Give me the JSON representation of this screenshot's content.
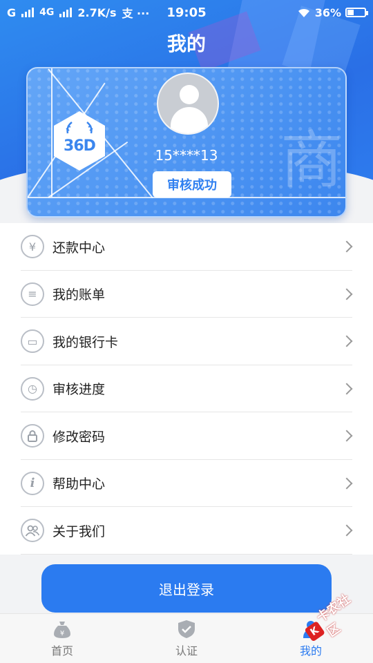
{
  "statusbar": {
    "left_carriers": "G",
    "left_4g": "4G",
    "speed": "2.7K/s",
    "extra": "支 ···",
    "time": "19:05",
    "battery": "36%"
  },
  "header": {
    "title": "我的"
  },
  "profile": {
    "badge_text": "36D",
    "watermark": "商",
    "phone": "15****13",
    "status": "审核成功"
  },
  "menu": {
    "items": [
      {
        "label": "还款中心",
        "icon": "repay-icon",
        "glyph": "¥"
      },
      {
        "label": "我的账单",
        "icon": "bill-icon",
        "glyph": "≡"
      },
      {
        "label": "我的银行卡",
        "icon": "bank-card-icon",
        "glyph": "▭"
      },
      {
        "label": "审核进度",
        "icon": "progress-icon",
        "glyph": "◷"
      },
      {
        "label": "修改密码",
        "icon": "lock-icon",
        "glyph": "🔒"
      },
      {
        "label": "帮助中心",
        "icon": "info-icon",
        "glyph": "i"
      },
      {
        "label": "关于我们",
        "icon": "users-icon",
        "glyph": "👥"
      }
    ]
  },
  "logout": {
    "label": "退出登录"
  },
  "tabbar": {
    "tabs": [
      {
        "label": "首页",
        "icon": "money-bag-icon"
      },
      {
        "label": "认证",
        "icon": "shield-check-icon"
      },
      {
        "label": "我的",
        "icon": "person-icon"
      }
    ],
    "active_index": 2
  },
  "watermark_logo": {
    "text": "卡农社区",
    "mark": "K"
  },
  "colors": {
    "primary": "#2b7bf0",
    "card": "#4b93f2"
  }
}
